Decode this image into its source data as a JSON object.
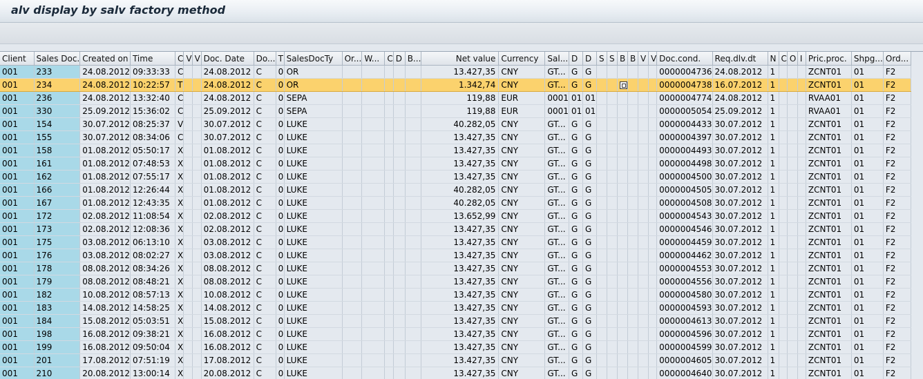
{
  "title": "alv display by salv factory method",
  "columns": [
    "Client",
    "Sales Doc.",
    "Created on",
    "Time",
    "C",
    "V",
    "V",
    "Doc. Date",
    "Do...",
    "T",
    "SalesDocTy",
    "Or...",
    "W...",
    "C",
    "D",
    "B...",
    "Net value",
    "Currency",
    "Sal...",
    "D",
    "D",
    "S",
    "S",
    "B",
    "B",
    "V",
    "V",
    "Doc.cond.",
    "Req.dlv.dt",
    "N",
    "C",
    "O",
    "I",
    "Pric.proc.",
    "Shpg...",
    "Ord..."
  ],
  "rows": [
    [
      "001",
      "233",
      "24.08.2012",
      "09:33:33",
      "C",
      "",
      "",
      "24.08.2012",
      "C",
      "0",
      "OR",
      "",
      "",
      "",
      "",
      "",
      "13.427,35",
      "CNY",
      "GT...",
      "G",
      "G",
      "",
      "",
      "",
      "",
      "",
      "",
      "0000004736",
      "24.08.2012",
      "1",
      "",
      "",
      "",
      "ZCNT01",
      "01",
      "F2"
    ],
    [
      "001",
      "234",
      "24.08.2012",
      "10:22:57",
      "T",
      "",
      "",
      "24.08.2012",
      "C",
      "0",
      "OR",
      "",
      "",
      "",
      "",
      "",
      "1.342,74",
      "CNY",
      "GT...",
      "G",
      "G",
      "",
      "",
      "",
      "",
      "",
      "",
      "0000004738",
      "16.07.2012",
      "1",
      "",
      "",
      "",
      "ZCNT01",
      "01",
      "F2"
    ],
    [
      "001",
      "236",
      "24.08.2012",
      "13:32:40",
      "C",
      "",
      "",
      "24.08.2012",
      "C",
      "0",
      "SEPA",
      "",
      "",
      "",
      "",
      "",
      "119,88",
      "EUR",
      "0001",
      "01",
      "01",
      "",
      "",
      "",
      "",
      "",
      "",
      "0000004774",
      "24.08.2012",
      "1",
      "",
      "",
      "",
      "RVAA01",
      "01",
      "F2"
    ],
    [
      "001",
      "330",
      "25.09.2012",
      "15:36:02",
      "C",
      "",
      "",
      "25.09.2012",
      "C",
      "0",
      "SEPA",
      "",
      "",
      "",
      "",
      "",
      "119,88",
      "EUR",
      "0001",
      "01",
      "01",
      "",
      "",
      "",
      "",
      "",
      "",
      "0000005054",
      "25.09.2012",
      "1",
      "",
      "",
      "",
      "RVAA01",
      "01",
      "F2"
    ],
    [
      "001",
      "154",
      "30.07.2012",
      "08:25:37",
      "V",
      "",
      "",
      "30.07.2012",
      "C",
      "0",
      "LUKE",
      "",
      "",
      "",
      "",
      "",
      "40.282,05",
      "CNY",
      "GT...",
      "G",
      "G",
      "",
      "",
      "",
      "",
      "",
      "",
      "0000004433",
      "30.07.2012",
      "1",
      "",
      "",
      "",
      "ZCNT01",
      "01",
      "F2"
    ],
    [
      "001",
      "155",
      "30.07.2012",
      "08:34:06",
      "C",
      "",
      "",
      "30.07.2012",
      "C",
      "0",
      "LUKE",
      "",
      "",
      "",
      "",
      "",
      "13.427,35",
      "CNY",
      "GT...",
      "G",
      "G",
      "",
      "",
      "",
      "",
      "",
      "",
      "0000004397",
      "30.07.2012",
      "1",
      "",
      "",
      "",
      "ZCNT01",
      "01",
      "F2"
    ],
    [
      "001",
      "158",
      "01.08.2012",
      "05:50:17",
      "X",
      "",
      "",
      "01.08.2012",
      "C",
      "0",
      "LUKE",
      "",
      "",
      "",
      "",
      "",
      "13.427,35",
      "CNY",
      "GT...",
      "G",
      "G",
      "",
      "",
      "",
      "",
      "",
      "",
      "0000004493",
      "30.07.2012",
      "1",
      "",
      "",
      "",
      "ZCNT01",
      "01",
      "F2"
    ],
    [
      "001",
      "161",
      "01.08.2012",
      "07:48:53",
      "X",
      "",
      "",
      "01.08.2012",
      "C",
      "0",
      "LUKE",
      "",
      "",
      "",
      "",
      "",
      "13.427,35",
      "CNY",
      "GT...",
      "G",
      "G",
      "",
      "",
      "",
      "",
      "",
      "",
      "0000004498",
      "30.07.2012",
      "1",
      "",
      "",
      "",
      "ZCNT01",
      "01",
      "F2"
    ],
    [
      "001",
      "162",
      "01.08.2012",
      "07:55:17",
      "X",
      "",
      "",
      "01.08.2012",
      "C",
      "0",
      "LUKE",
      "",
      "",
      "",
      "",
      "",
      "13.427,35",
      "CNY",
      "GT...",
      "G",
      "G",
      "",
      "",
      "",
      "",
      "",
      "",
      "0000004500",
      "30.07.2012",
      "1",
      "",
      "",
      "",
      "ZCNT01",
      "01",
      "F2"
    ],
    [
      "001",
      "166",
      "01.08.2012",
      "12:26:44",
      "X",
      "",
      "",
      "01.08.2012",
      "C",
      "0",
      "LUKE",
      "",
      "",
      "",
      "",
      "",
      "40.282,05",
      "CNY",
      "GT...",
      "G",
      "G",
      "",
      "",
      "",
      "",
      "",
      "",
      "0000004505",
      "30.07.2012",
      "1",
      "",
      "",
      "",
      "ZCNT01",
      "01",
      "F2"
    ],
    [
      "001",
      "167",
      "01.08.2012",
      "12:43:35",
      "X",
      "",
      "",
      "01.08.2012",
      "C",
      "0",
      "LUKE",
      "",
      "",
      "",
      "",
      "",
      "40.282,05",
      "CNY",
      "GT...",
      "G",
      "G",
      "",
      "",
      "",
      "",
      "",
      "",
      "0000004508",
      "30.07.2012",
      "1",
      "",
      "",
      "",
      "ZCNT01",
      "01",
      "F2"
    ],
    [
      "001",
      "172",
      "02.08.2012",
      "11:08:54",
      "X",
      "",
      "",
      "02.08.2012",
      "C",
      "0",
      "LUKE",
      "",
      "",
      "",
      "",
      "",
      "13.652,99",
      "CNY",
      "GT...",
      "G",
      "G",
      "",
      "",
      "",
      "",
      "",
      "",
      "0000004543",
      "30.07.2012",
      "1",
      "",
      "",
      "",
      "ZCNT01",
      "01",
      "F2"
    ],
    [
      "001",
      "173",
      "02.08.2012",
      "12:08:36",
      "X",
      "",
      "",
      "02.08.2012",
      "C",
      "0",
      "LUKE",
      "",
      "",
      "",
      "",
      "",
      "13.427,35",
      "CNY",
      "GT...",
      "G",
      "G",
      "",
      "",
      "",
      "",
      "",
      "",
      "0000004546",
      "30.07.2012",
      "1",
      "",
      "",
      "",
      "ZCNT01",
      "01",
      "F2"
    ],
    [
      "001",
      "175",
      "03.08.2012",
      "06:13:10",
      "X",
      "",
      "",
      "03.08.2012",
      "C",
      "0",
      "LUKE",
      "",
      "",
      "",
      "",
      "",
      "13.427,35",
      "CNY",
      "GT...",
      "G",
      "G",
      "",
      "",
      "",
      "",
      "",
      "",
      "0000004459",
      "30.07.2012",
      "1",
      "",
      "",
      "",
      "ZCNT01",
      "01",
      "F2"
    ],
    [
      "001",
      "176",
      "03.08.2012",
      "08:02:27",
      "X",
      "",
      "",
      "03.08.2012",
      "C",
      "0",
      "LUKE",
      "",
      "",
      "",
      "",
      "",
      "13.427,35",
      "CNY",
      "GT...",
      "G",
      "G",
      "",
      "",
      "",
      "",
      "",
      "",
      "0000004462",
      "30.07.2012",
      "1",
      "",
      "",
      "",
      "ZCNT01",
      "01",
      "F2"
    ],
    [
      "001",
      "178",
      "08.08.2012",
      "08:34:26",
      "X",
      "",
      "",
      "08.08.2012",
      "C",
      "0",
      "LUKE",
      "",
      "",
      "",
      "",
      "",
      "13.427,35",
      "CNY",
      "GT...",
      "G",
      "G",
      "",
      "",
      "",
      "",
      "",
      "",
      "0000004553",
      "30.07.2012",
      "1",
      "",
      "",
      "",
      "ZCNT01",
      "01",
      "F2"
    ],
    [
      "001",
      "179",
      "08.08.2012",
      "08:48:21",
      "X",
      "",
      "",
      "08.08.2012",
      "C",
      "0",
      "LUKE",
      "",
      "",
      "",
      "",
      "",
      "13.427,35",
      "CNY",
      "GT...",
      "G",
      "G",
      "",
      "",
      "",
      "",
      "",
      "",
      "0000004556",
      "30.07.2012",
      "1",
      "",
      "",
      "",
      "ZCNT01",
      "01",
      "F2"
    ],
    [
      "001",
      "182",
      "10.08.2012",
      "08:57:13",
      "X",
      "",
      "",
      "10.08.2012",
      "C",
      "0",
      "LUKE",
      "",
      "",
      "",
      "",
      "",
      "13.427,35",
      "CNY",
      "GT...",
      "G",
      "G",
      "",
      "",
      "",
      "",
      "",
      "",
      "0000004580",
      "30.07.2012",
      "1",
      "",
      "",
      "",
      "ZCNT01",
      "01",
      "F2"
    ],
    [
      "001",
      "183",
      "14.08.2012",
      "14:58:25",
      "X",
      "",
      "",
      "14.08.2012",
      "C",
      "0",
      "LUKE",
      "",
      "",
      "",
      "",
      "",
      "13.427,35",
      "CNY",
      "GT...",
      "G",
      "G",
      "",
      "",
      "",
      "",
      "",
      "",
      "0000004593",
      "30.07.2012",
      "1",
      "",
      "",
      "",
      "ZCNT01",
      "01",
      "F2"
    ],
    [
      "001",
      "184",
      "15.08.2012",
      "05:03:51",
      "X",
      "",
      "",
      "15.08.2012",
      "C",
      "0",
      "LUKE",
      "",
      "",
      "",
      "",
      "",
      "13.427,35",
      "CNY",
      "GT...",
      "G",
      "G",
      "",
      "",
      "",
      "",
      "",
      "",
      "0000004613",
      "30.07.2012",
      "1",
      "",
      "",
      "",
      "ZCNT01",
      "01",
      "F2"
    ],
    [
      "001",
      "198",
      "16.08.2012",
      "09:38:21",
      "X",
      "",
      "",
      "16.08.2012",
      "C",
      "0",
      "LUKE",
      "",
      "",
      "",
      "",
      "",
      "13.427,35",
      "CNY",
      "GT...",
      "G",
      "G",
      "",
      "",
      "",
      "",
      "",
      "",
      "0000004596",
      "30.07.2012",
      "1",
      "",
      "",
      "",
      "ZCNT01",
      "01",
      "F2"
    ],
    [
      "001",
      "199",
      "16.08.2012",
      "09:50:04",
      "X",
      "",
      "",
      "16.08.2012",
      "C",
      "0",
      "LUKE",
      "",
      "",
      "",
      "",
      "",
      "13.427,35",
      "CNY",
      "GT...",
      "G",
      "G",
      "",
      "",
      "",
      "",
      "",
      "",
      "0000004599",
      "30.07.2012",
      "1",
      "",
      "",
      "",
      "ZCNT01",
      "01",
      "F2"
    ],
    [
      "001",
      "201",
      "17.08.2012",
      "07:51:19",
      "X",
      "",
      "",
      "17.08.2012",
      "C",
      "0",
      "LUKE",
      "",
      "",
      "",
      "",
      "",
      "13.427,35",
      "CNY",
      "GT...",
      "G",
      "G",
      "",
      "",
      "",
      "",
      "",
      "",
      "0000004605",
      "30.07.2012",
      "1",
      "",
      "",
      "",
      "ZCNT01",
      "01",
      "F2"
    ],
    [
      "001",
      "210",
      "20.08.2012",
      "13:00:14",
      "X",
      "",
      "",
      "20.08.2012",
      "C",
      "0",
      "LUKE",
      "",
      "",
      "",
      "",
      "",
      "13.427,35",
      "CNY",
      "GT...",
      "G",
      "G",
      "",
      "",
      "",
      "",
      "",
      "",
      "0000004640",
      "30.07.2012",
      "1",
      "",
      "",
      "",
      "ZCNT01",
      "01",
      "F2"
    ]
  ],
  "selected_row_index": 1,
  "icon_cell": {
    "row": 1,
    "column": 23,
    "icon": "multiple-selection-icon"
  },
  "colors": {
    "key_column": "#a9d9e8",
    "selected_row": "#fbd26d",
    "grid_background": "#e4e9ef"
  }
}
